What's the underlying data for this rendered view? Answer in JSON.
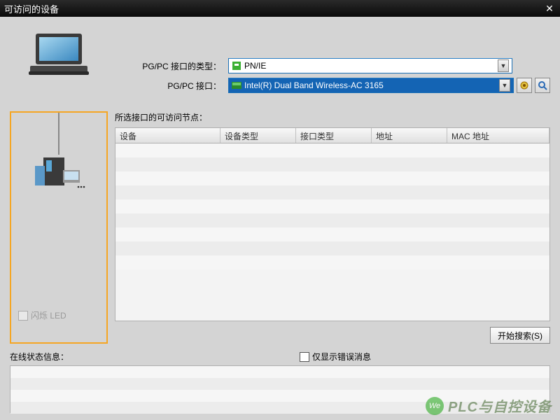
{
  "window": {
    "title": "可访问的设备"
  },
  "form": {
    "interface_type_label": "PG/PC 接口的类型：",
    "interface_type_value": "PN/IE",
    "interface_label": "PG/PC 接口：",
    "interface_value": "Intel(R) Dual Band Wireless-AC 3165"
  },
  "nodes_label": "所选接口的可访问节点：",
  "table": {
    "headers": [
      "设备",
      "设备类型",
      "接口类型",
      "地址",
      "MAC 地址"
    ]
  },
  "led_label": "闪烁 LED",
  "search_button": "开始搜索(S)",
  "status_label": "在线状态信息：",
  "error_only_label": "仅显示错误消息",
  "watermark": "PLC与自控设备"
}
